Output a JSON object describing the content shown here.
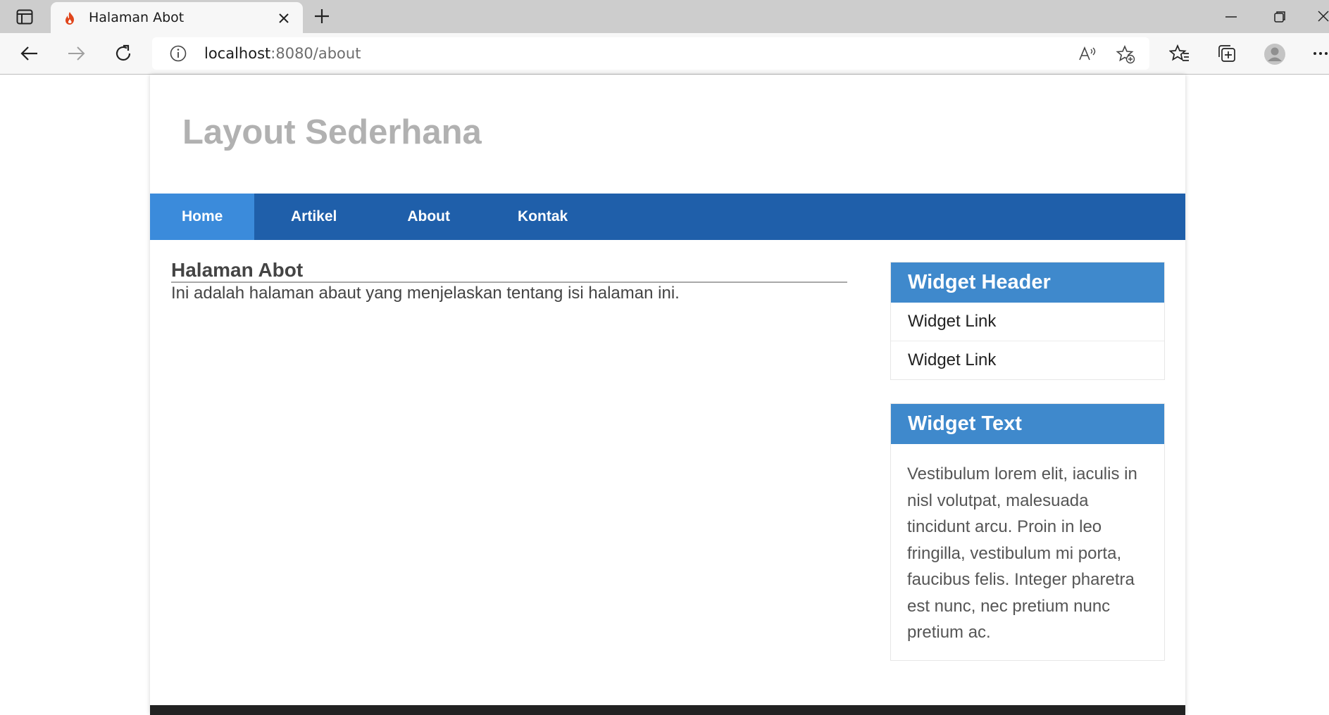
{
  "browser": {
    "tab_title": "Halaman Abot",
    "url_host": "localhost",
    "url_path": ":8080/about"
  },
  "site": {
    "title": "Layout Sederhana"
  },
  "nav": {
    "items": [
      {
        "label": "Home",
        "active": true
      },
      {
        "label": "Artikel",
        "active": false
      },
      {
        "label": "About",
        "active": false
      },
      {
        "label": "Kontak",
        "active": false
      }
    ]
  },
  "content": {
    "heading": "Halaman Abot",
    "body": "Ini adalah halaman abaut yang menjelaskan tentang isi halaman ini."
  },
  "sidebar": {
    "widget1": {
      "header": "Widget Header",
      "links": [
        "Widget Link",
        "Widget Link"
      ]
    },
    "widget2": {
      "header": "Widget Text",
      "text": "Vestibulum lorem elit, iaculis in nisl volutpat, malesuada tincidunt arcu. Proin in leo fringilla, vestibulum mi porta, faucibus felis. Integer pharetra est nunc, nec pretium nunc pretium ac."
    }
  },
  "colors": {
    "nav_bg": "#1f5faa",
    "nav_active": "#3b8bdb",
    "widget_header": "#3f89cc",
    "site_title": "#b1b1b1"
  }
}
